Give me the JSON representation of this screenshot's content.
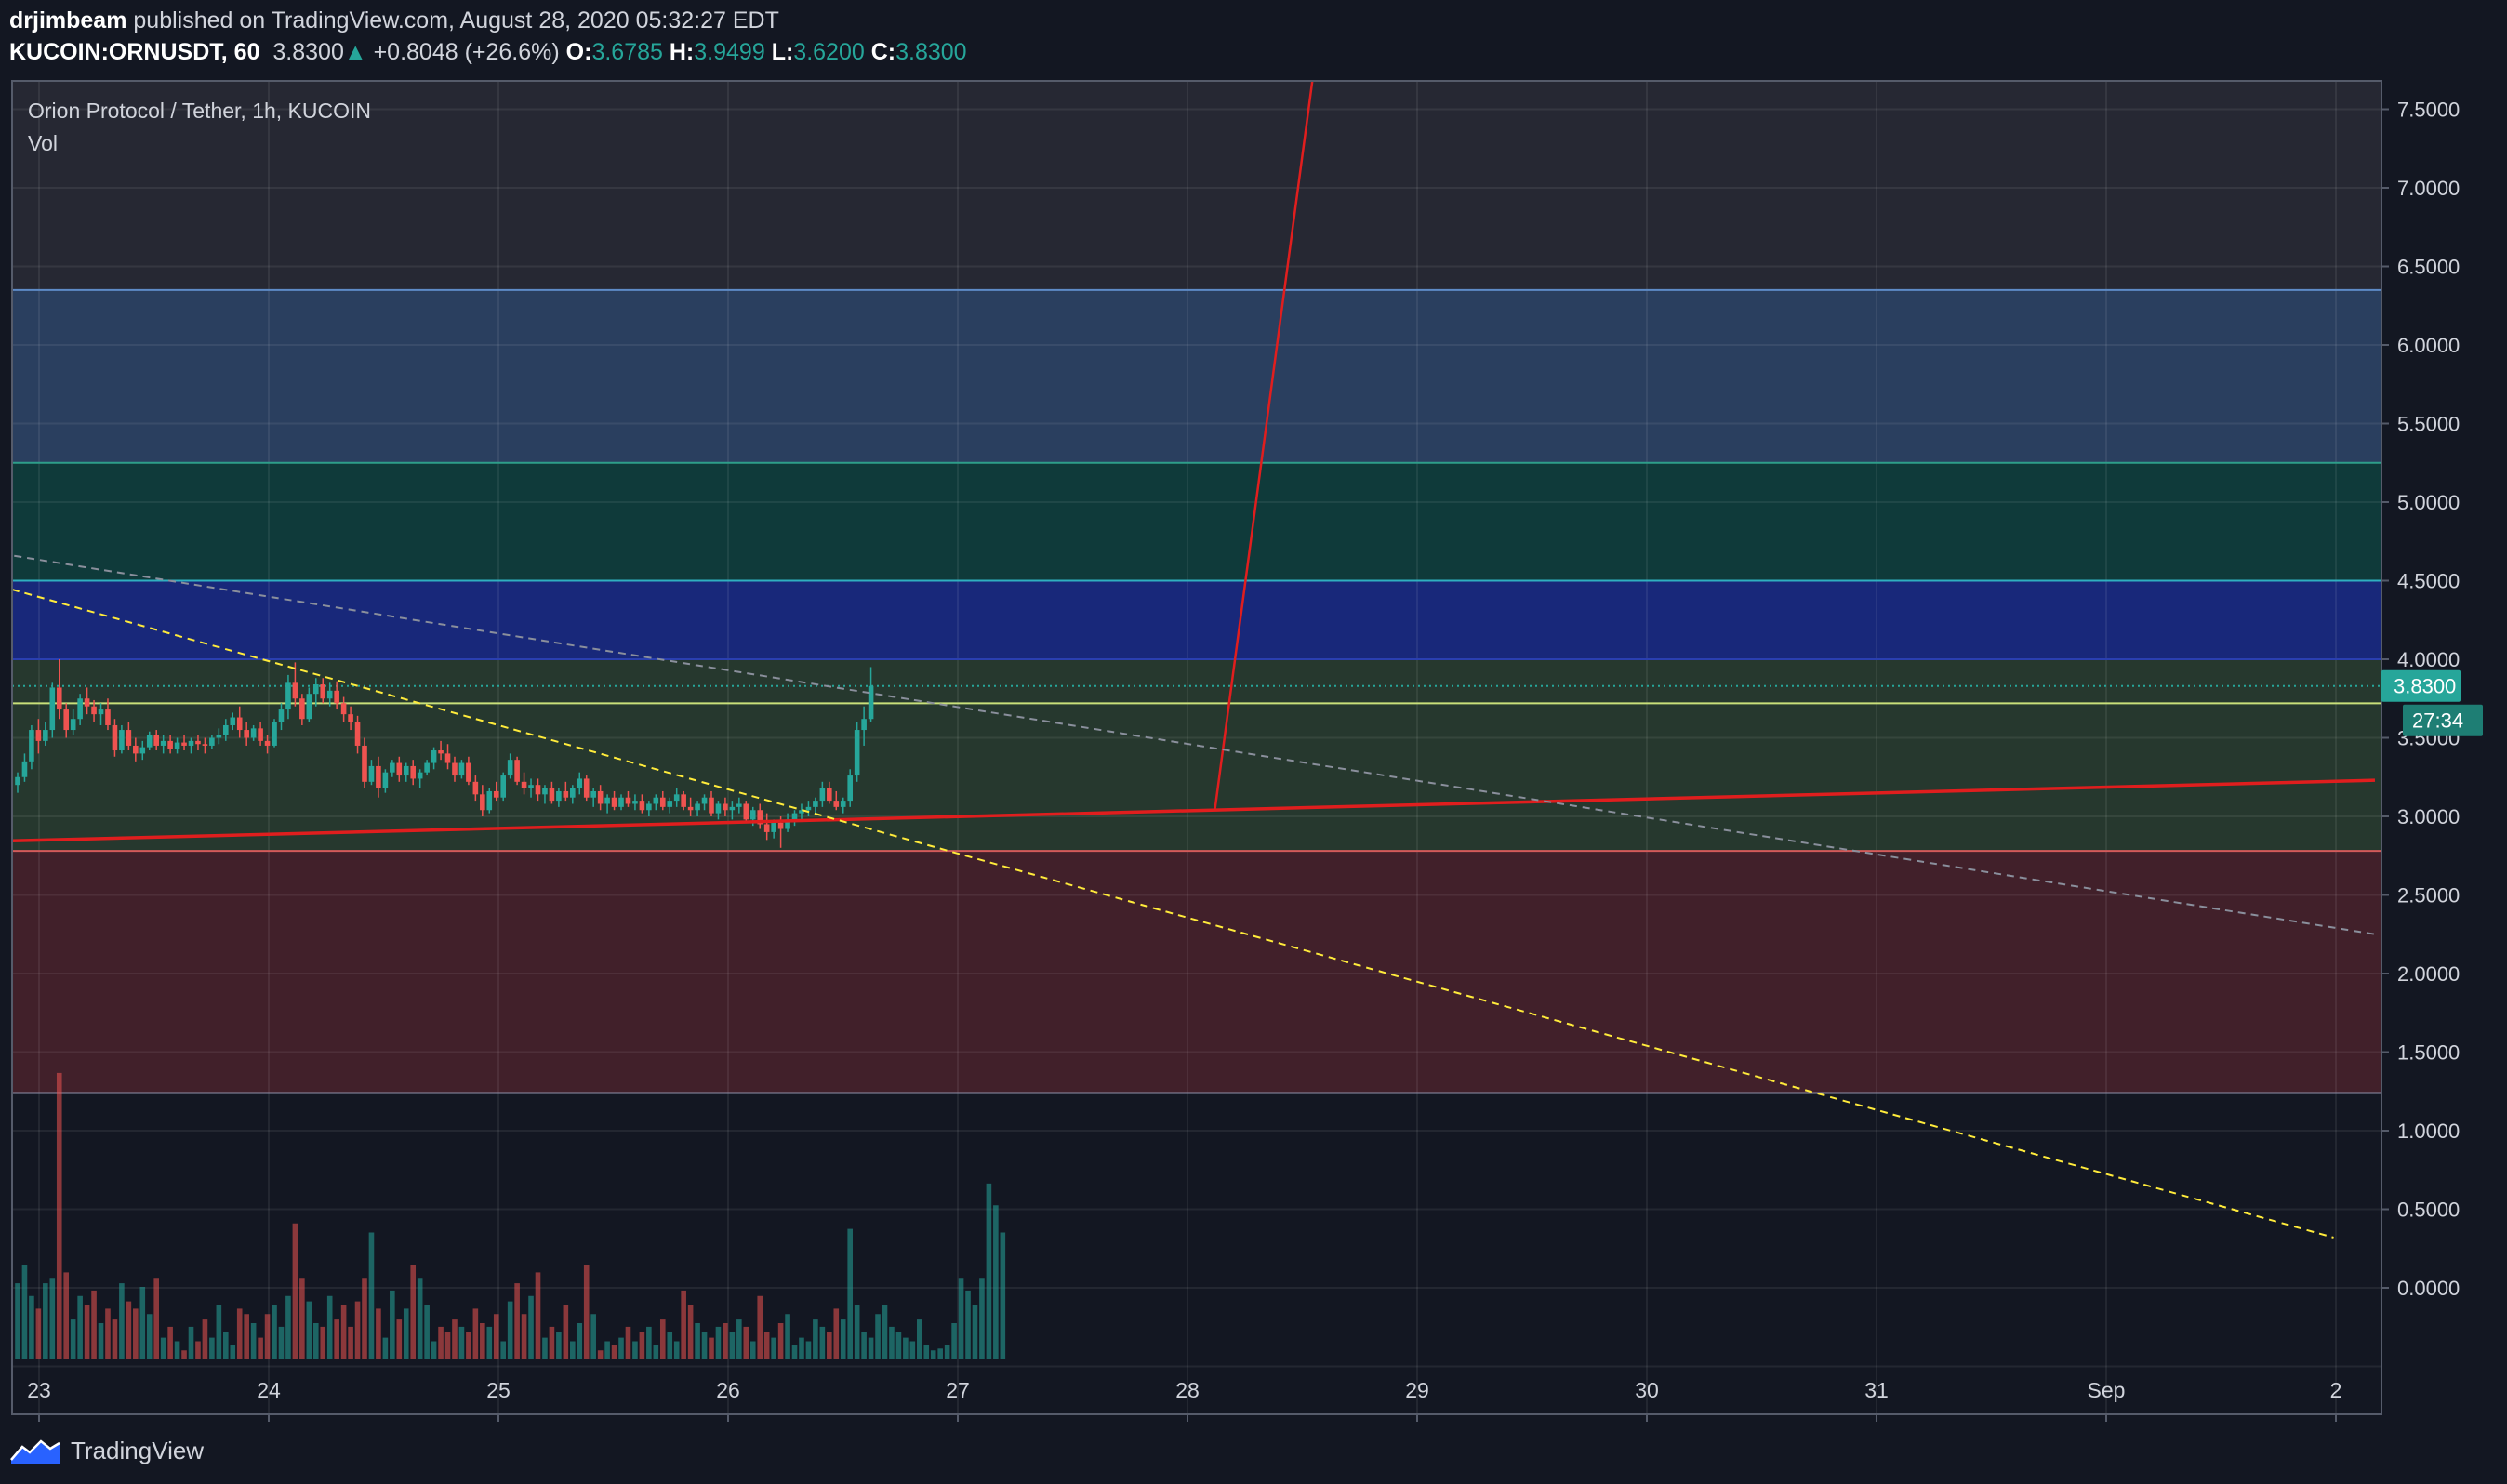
{
  "header": {
    "publisher": "drjimbeam",
    "published_text": "published on TradingView.com, August 28, 2020 05:32:27 EDT",
    "symbol": "KUCOIN:ORNUSDT, 60",
    "last": "3.8300",
    "change": "+0.8048 (+26.6%)",
    "o_label": "O:",
    "o": "3.6785",
    "h_label": "H:",
    "h": "3.9499",
    "l_label": "L:",
    "l": "3.6200",
    "c_label": "C:",
    "c": "3.8300"
  },
  "legend": {
    "title": "Orion Protocol / Tether, 1h, KUCOIN",
    "volume": "Vol"
  },
  "price_badge": "3.8300",
  "countdown_badge": "27:34",
  "footer": {
    "brand": "TradingView"
  },
  "colors": {
    "background": "#131722",
    "up": "#26a69a",
    "down": "#ef5350",
    "trendline": "#e01e1e",
    "diagonal": "#ffeb3b"
  },
  "chart_data": {
    "type": "candlestick",
    "symbol": "ORNUSDT",
    "exchange": "KUCOIN",
    "interval": "1h",
    "y_axis": {
      "min": -0.45,
      "max": 7.75,
      "ticks": [
        "7.5000",
        "7.0000",
        "6.5000",
        "6.0000",
        "5.5000",
        "5.0000",
        "4.5000",
        "4.0000",
        "3.5000",
        "3.0000",
        "2.5000",
        "2.0000",
        "1.5000",
        "1.0000",
        "0.5000",
        "0.0000"
      ]
    },
    "x_axis": {
      "ticks": [
        "23",
        "24",
        "25",
        "26",
        "27",
        "28",
        "29",
        "30",
        "31",
        "Sep",
        "2"
      ]
    },
    "last_price": 3.83,
    "zones": [
      {
        "from": 5.25,
        "to": 6.35,
        "color": "#2a3f5f"
      },
      {
        "from": 4.5,
        "to": 5.25,
        "color": "#0f3a3a"
      },
      {
        "from": 4.0,
        "to": 4.5,
        "color": "#18287a"
      },
      {
        "from": 2.78,
        "to": 4.0,
        "color": "#26382e"
      },
      {
        "from": 1.24,
        "to": 2.78,
        "color": "#41202a"
      }
    ],
    "levels": [
      6.35,
      5.25,
      4.5,
      4.0,
      3.72,
      2.78,
      1.24
    ],
    "trendlines": [
      {
        "name": "support",
        "from": {
          "x": 22.5,
          "y": 2.83
        },
        "to": {
          "x": 33.17,
          "y": 3.23
        },
        "style": "solid"
      },
      {
        "name": "breakout",
        "from": {
          "x": 28.12,
          "y": 3.05
        },
        "to": {
          "x": 28.55,
          "y": 7.75
        },
        "style": "solid"
      },
      {
        "name": "descending",
        "from": {
          "x": 22.5,
          "y": 4.6
        },
        "to": {
          "x": 32.99,
          "y": 0.32
        },
        "style": "dashed"
      },
      {
        "name": "descending-2",
        "from": {
          "x": 22.5,
          "y": 4.75
        },
        "to": {
          "x": 33.17,
          "y": 2.25
        },
        "style": "dashed"
      }
    ],
    "candles": [
      [
        3.2,
        3.28,
        3.15,
        3.25
      ],
      [
        3.25,
        3.4,
        3.22,
        3.35
      ],
      [
        3.35,
        3.58,
        3.3,
        3.55
      ],
      [
        3.55,
        3.62,
        3.4,
        3.48
      ],
      [
        3.48,
        3.6,
        3.45,
        3.55
      ],
      [
        3.55,
        3.85,
        3.5,
        3.82
      ],
      [
        3.82,
        4.0,
        3.62,
        3.68
      ],
      [
        3.68,
        3.72,
        3.5,
        3.55
      ],
      [
        3.55,
        3.68,
        3.52,
        3.62
      ],
      [
        3.62,
        3.78,
        3.58,
        3.75
      ],
      [
        3.75,
        3.82,
        3.65,
        3.7
      ],
      [
        3.7,
        3.74,
        3.6,
        3.65
      ],
      [
        3.65,
        3.72,
        3.58,
        3.68
      ],
      [
        3.68,
        3.75,
        3.55,
        3.58
      ],
      [
        3.58,
        3.62,
        3.38,
        3.42
      ],
      [
        3.42,
        3.58,
        3.4,
        3.55
      ],
      [
        3.55,
        3.6,
        3.42,
        3.45
      ],
      [
        3.45,
        3.5,
        3.35,
        3.4
      ],
      [
        3.4,
        3.48,
        3.36,
        3.44
      ],
      [
        3.44,
        3.54,
        3.42,
        3.52
      ],
      [
        3.52,
        3.55,
        3.42,
        3.45
      ],
      [
        3.45,
        3.52,
        3.4,
        3.48
      ],
      [
        3.48,
        3.52,
        3.4,
        3.43
      ],
      [
        3.43,
        3.5,
        3.4,
        3.47
      ],
      [
        3.47,
        3.52,
        3.42,
        3.45
      ],
      [
        3.45,
        3.5,
        3.4,
        3.48
      ],
      [
        3.48,
        3.52,
        3.42,
        3.46
      ],
      [
        3.46,
        3.5,
        3.4,
        3.45
      ],
      [
        3.45,
        3.52,
        3.43,
        3.5
      ],
      [
        3.5,
        3.56,
        3.46,
        3.52
      ],
      [
        3.52,
        3.62,
        3.48,
        3.58
      ],
      [
        3.58,
        3.66,
        3.55,
        3.63
      ],
      [
        3.63,
        3.7,
        3.5,
        3.55
      ],
      [
        3.55,
        3.6,
        3.45,
        3.5
      ],
      [
        3.5,
        3.58,
        3.48,
        3.56
      ],
      [
        3.56,
        3.6,
        3.45,
        3.48
      ],
      [
        3.48,
        3.52,
        3.4,
        3.45
      ],
      [
        3.45,
        3.62,
        3.44,
        3.6
      ],
      [
        3.6,
        3.72,
        3.55,
        3.68
      ],
      [
        3.68,
        3.9,
        3.62,
        3.85
      ],
      [
        3.85,
        3.98,
        3.7,
        3.75
      ],
      [
        3.75,
        3.78,
        3.58,
        3.62
      ],
      [
        3.62,
        3.82,
        3.6,
        3.78
      ],
      [
        3.78,
        3.88,
        3.7,
        3.84
      ],
      [
        3.84,
        3.88,
        3.72,
        3.75
      ],
      [
        3.75,
        3.85,
        3.7,
        3.8
      ],
      [
        3.8,
        3.86,
        3.68,
        3.72
      ],
      [
        3.72,
        3.76,
        3.6,
        3.65
      ],
      [
        3.65,
        3.7,
        3.55,
        3.6
      ],
      [
        3.6,
        3.64,
        3.4,
        3.45
      ],
      [
        3.45,
        3.5,
        3.18,
        3.22
      ],
      [
        3.22,
        3.36,
        3.2,
        3.32
      ],
      [
        3.32,
        3.38,
        3.12,
        3.18
      ],
      [
        3.18,
        3.3,
        3.15,
        3.28
      ],
      [
        3.28,
        3.36,
        3.25,
        3.34
      ],
      [
        3.34,
        3.38,
        3.22,
        3.26
      ],
      [
        3.26,
        3.34,
        3.22,
        3.32
      ],
      [
        3.32,
        3.36,
        3.2,
        3.24
      ],
      [
        3.24,
        3.3,
        3.18,
        3.28
      ],
      [
        3.28,
        3.36,
        3.26,
        3.34
      ],
      [
        3.34,
        3.44,
        3.3,
        3.42
      ],
      [
        3.42,
        3.48,
        3.36,
        3.4
      ],
      [
        3.4,
        3.46,
        3.3,
        3.34
      ],
      [
        3.34,
        3.38,
        3.22,
        3.26
      ],
      [
        3.26,
        3.36,
        3.24,
        3.34
      ],
      [
        3.34,
        3.38,
        3.2,
        3.22
      ],
      [
        3.22,
        3.26,
        3.1,
        3.14
      ],
      [
        3.14,
        3.2,
        3.0,
        3.04
      ],
      [
        3.04,
        3.18,
        3.02,
        3.16
      ],
      [
        3.16,
        3.22,
        3.1,
        3.12
      ],
      [
        3.12,
        3.28,
        3.1,
        3.26
      ],
      [
        3.26,
        3.4,
        3.24,
        3.36
      ],
      [
        3.36,
        3.38,
        3.2,
        3.22
      ],
      [
        3.22,
        3.28,
        3.14,
        3.18
      ],
      [
        3.18,
        3.24,
        3.12,
        3.2
      ],
      [
        3.2,
        3.24,
        3.1,
        3.14
      ],
      [
        3.14,
        3.2,
        3.08,
        3.18
      ],
      [
        3.18,
        3.22,
        3.08,
        3.1
      ],
      [
        3.1,
        3.18,
        3.06,
        3.16
      ],
      [
        3.16,
        3.22,
        3.1,
        3.12
      ],
      [
        3.12,
        3.2,
        3.08,
        3.18
      ],
      [
        3.18,
        3.28,
        3.14,
        3.24
      ],
      [
        3.24,
        3.26,
        3.1,
        3.12
      ],
      [
        3.12,
        3.18,
        3.06,
        3.16
      ],
      [
        3.16,
        3.2,
        3.04,
        3.08
      ],
      [
        3.08,
        3.14,
        3.02,
        3.12
      ],
      [
        3.12,
        3.16,
        3.04,
        3.06
      ],
      [
        3.06,
        3.14,
        3.04,
        3.12
      ],
      [
        3.12,
        3.16,
        3.06,
        3.08
      ],
      [
        3.08,
        3.14,
        3.04,
        3.1
      ],
      [
        3.1,
        3.14,
        3.02,
        3.04
      ],
      [
        3.04,
        3.1,
        3.0,
        3.08
      ],
      [
        3.08,
        3.14,
        3.04,
        3.12
      ],
      [
        3.12,
        3.16,
        3.04,
        3.06
      ],
      [
        3.06,
        3.12,
        3.02,
        3.1
      ],
      [
        3.1,
        3.18,
        3.06,
        3.14
      ],
      [
        3.14,
        3.16,
        3.04,
        3.06
      ],
      [
        3.06,
        3.12,
        3.0,
        3.04
      ],
      [
        3.04,
        3.1,
        3.0,
        3.08
      ],
      [
        3.08,
        3.14,
        3.04,
        3.12
      ],
      [
        3.12,
        3.16,
        3.0,
        3.02
      ],
      [
        3.02,
        3.1,
        2.98,
        3.08
      ],
      [
        3.08,
        3.12,
        3.0,
        3.04
      ],
      [
        3.04,
        3.1,
        2.98,
        3.06
      ],
      [
        3.06,
        3.12,
        3.02,
        3.08
      ],
      [
        3.08,
        3.1,
        2.96,
        2.98
      ],
      [
        2.98,
        3.06,
        2.94,
        3.04
      ],
      [
        3.04,
        3.08,
        2.92,
        2.95
      ],
      [
        2.95,
        3.02,
        2.85,
        2.9
      ],
      [
        2.9,
        2.98,
        2.86,
        2.96
      ],
      [
        2.96,
        3.0,
        2.8,
        2.92
      ],
      [
        2.92,
        3.02,
        2.9,
        2.98
      ],
      [
        2.98,
        3.04,
        2.94,
        3.02
      ],
      [
        3.02,
        3.08,
        2.98,
        3.04
      ],
      [
        3.04,
        3.1,
        3.0,
        3.06
      ],
      [
        3.06,
        3.12,
        3.02,
        3.1
      ],
      [
        3.1,
        3.22,
        3.06,
        3.18
      ],
      [
        3.18,
        3.22,
        3.08,
        3.1
      ],
      [
        3.1,
        3.16,
        3.04,
        3.06
      ],
      [
        3.06,
        3.12,
        3.02,
        3.1
      ],
      [
        3.1,
        3.3,
        3.06,
        3.26
      ],
      [
        3.26,
        3.6,
        3.22,
        3.55
      ],
      [
        3.55,
        3.7,
        3.45,
        3.62
      ],
      [
        3.62,
        3.95,
        3.6,
        3.83
      ]
    ],
    "volumes": [
      0.42,
      0.52,
      0.35,
      0.28,
      0.42,
      0.45,
      1.58,
      0.48,
      0.22,
      0.35,
      0.3,
      0.38,
      0.2,
      0.28,
      0.22,
      0.42,
      0.32,
      0.28,
      0.4,
      0.25,
      0.45,
      0.12,
      0.18,
      0.1,
      0.05,
      0.18,
      0.1,
      0.22,
      0.12,
      0.3,
      0.15,
      0.08,
      0.28,
      0.25,
      0.2,
      0.12,
      0.25,
      0.3,
      0.18,
      0.35,
      0.75,
      0.45,
      0.32,
      0.2,
      0.18,
      0.35,
      0.22,
      0.3,
      0.18,
      0.32,
      0.45,
      0.7,
      0.28,
      0.12,
      0.38,
      0.22,
      0.28,
      0.52,
      0.45,
      0.3,
      0.1,
      0.18,
      0.15,
      0.22,
      0.18,
      0.15,
      0.28,
      0.2,
      0.18,
      0.25,
      0.1,
      0.32,
      0.42,
      0.25,
      0.35,
      0.48,
      0.12,
      0.18,
      0.15,
      0.3,
      0.1,
      0.2,
      0.52,
      0.25,
      0.05,
      0.1,
      0.08,
      0.12,
      0.18,
      0.1,
      0.15,
      0.18,
      0.08,
      0.22,
      0.15,
      0.1,
      0.38,
      0.3,
      0.2,
      0.15,
      0.12,
      0.18,
      0.2,
      0.15,
      0.22,
      0.18,
      0.1,
      0.35,
      0.15,
      0.12,
      0.2,
      0.25,
      0.08,
      0.12,
      0.1,
      0.22,
      0.18,
      0.15,
      0.28,
      0.22,
      0.72,
      0.3,
      0.15,
      0.12,
      0.25,
      0.3,
      0.18,
      0.15,
      0.12,
      0.1,
      0.22,
      0.08,
      0.05,
      0.06,
      0.08,
      0.2,
      0.45,
      0.38,
      0.3,
      0.45,
      0.97,
      0.85,
      0.7
    ]
  }
}
